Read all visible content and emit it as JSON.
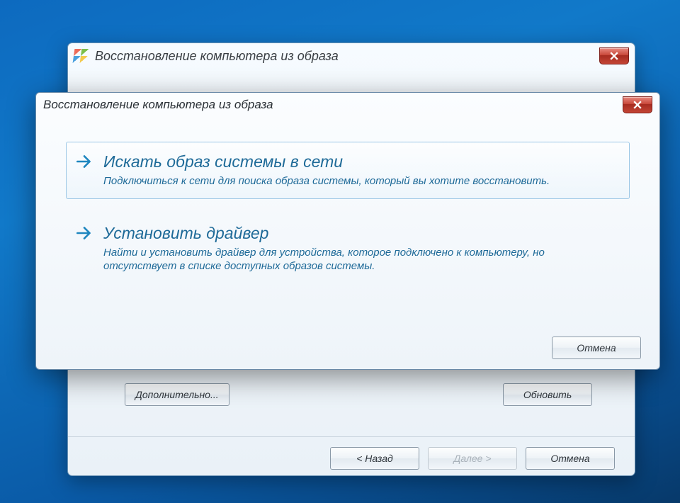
{
  "back_window": {
    "title": "Восстановление компьютера из образа",
    "buttons": {
      "advanced": "Дополнительно...",
      "refresh": "Обновить",
      "back": "< Назад",
      "next": "Далее >",
      "cancel": "Отмена"
    },
    "next_enabled": false
  },
  "dialog": {
    "title": "Восстановление компьютера из образа",
    "options": [
      {
        "heading": "Искать образ системы в сети",
        "desc": "Подключиться к сети для поиска образа системы, который вы хотите восстановить."
      },
      {
        "heading": "Установить драйвер",
        "desc": "Найти и установить драйвер для устройства, которое подключено к компьютеру, но отсутствует в списке доступных образов системы."
      }
    ],
    "cancel": "Отмена"
  }
}
